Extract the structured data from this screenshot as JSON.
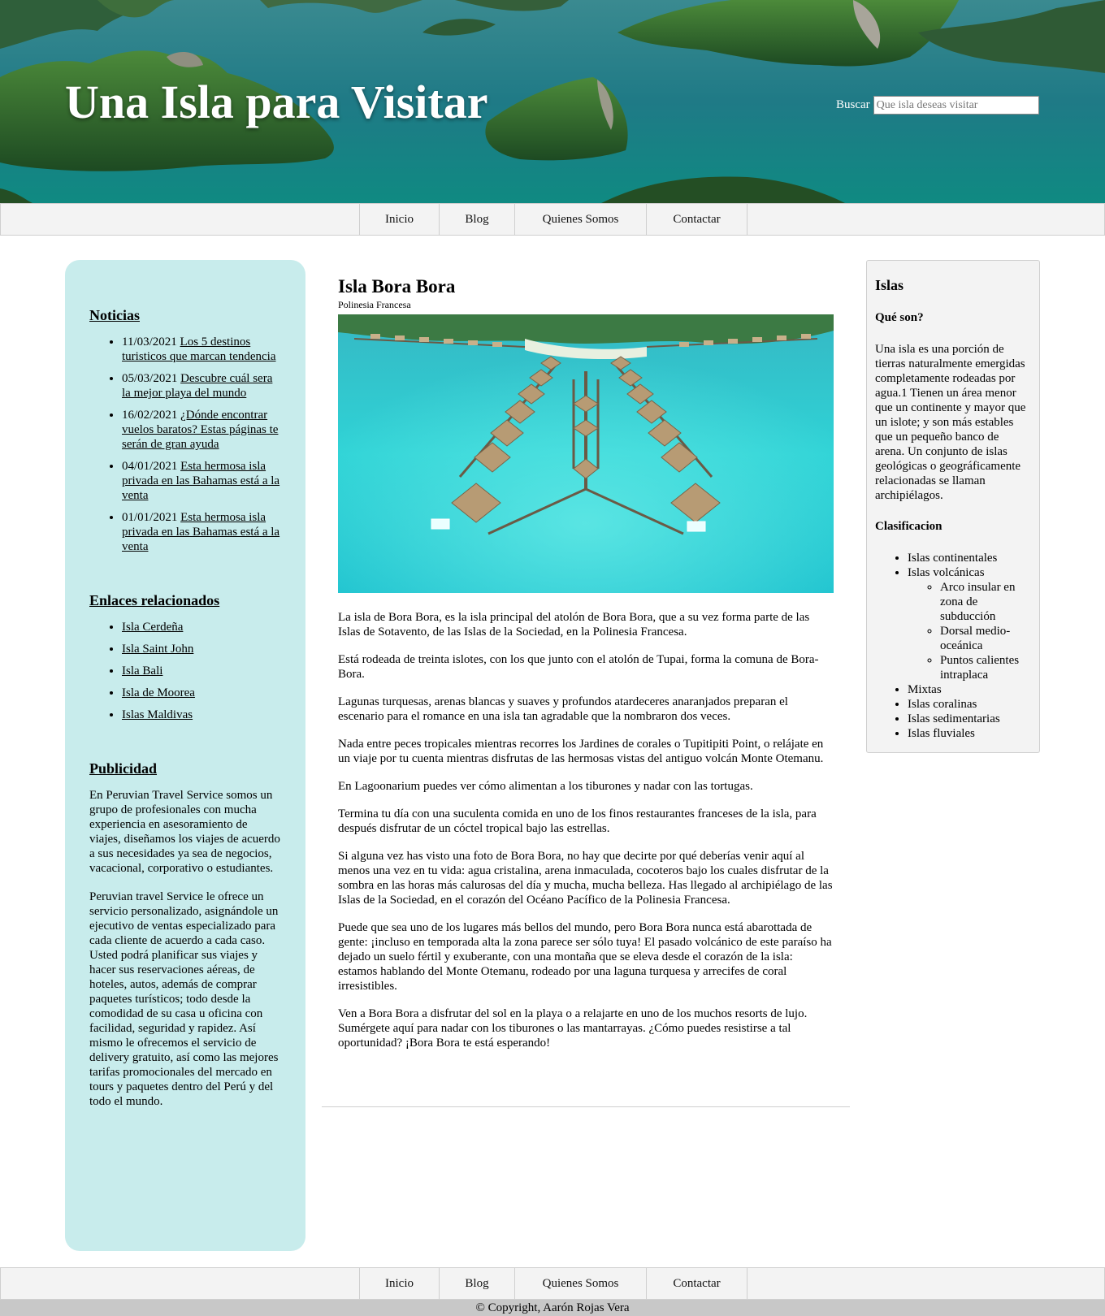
{
  "header": {
    "title": "Una Isla para Visitar",
    "search_label": "Buscar",
    "search_placeholder": "Que isla deseas visitar",
    "search_value": ""
  },
  "nav": {
    "items": [
      {
        "label": "Inicio"
      },
      {
        "label": "Blog"
      },
      {
        "label": "Quienes Somos"
      },
      {
        "label": "Contactar"
      }
    ]
  },
  "sidebar_left": {
    "news_title": "Noticias",
    "news": [
      {
        "date": "11/03/2021",
        "link": "Los 5 destinos turisticos que marcan tendencia"
      },
      {
        "date": "05/03/2021",
        "link": "Descubre cuál sera la mejor playa del mundo"
      },
      {
        "date": "16/02/2021",
        "link": "¿Dónde encontrar vuelos baratos? Estas páginas te serán de gran ayuda"
      },
      {
        "date": "04/01/2021",
        "link": "Esta hermosa isla privada en las Bahamas está a la venta"
      },
      {
        "date": "01/01/2021",
        "link": "Esta hermosa isla privada en las Bahamas está a la venta"
      }
    ],
    "links_title": "Enlaces relacionados",
    "links": [
      {
        "label": "Isla Cerdeña"
      },
      {
        "label": "Isla Saint John"
      },
      {
        "label": "Isla Bali"
      },
      {
        "label": "Isla de Moorea"
      },
      {
        "label": "Islas Maldivas"
      }
    ],
    "ads_title": "Publicidad",
    "ads_paragraphs": [
      "En Peruvian Travel Service somos un grupo de profesionales con mucha experiencia en asesoramiento de viajes, diseñamos los viajes de acuerdo a sus necesidades ya sea de negocios, vacacional, corporativo o estudiantes.",
      "Peruvian travel Service le ofrece un servicio personalizado, asignándole un ejecutivo de ventas especializado para cada cliente de acuerdo a cada caso. Usted podrá planificar sus viajes y hacer sus reservaciones aéreas, de hoteles, autos, además de comprar paquetes turísticos; todo desde la comodidad de su casa u oficina con facilidad, seguridad y rapidez. Así mismo le ofrecemos el servicio de delivery gratuito, así como las mejores tarifas promocionales del mercado en tours y paquetes dentro del Perú y del todo el mundo."
    ]
  },
  "main": {
    "title": "Isla Bora Bora",
    "subtitle": "Polinesia Francesa",
    "paragraphs": [
      "La isla de Bora Bora, es la isla principal del atolón de Bora Bora, que a su vez forma parte de las Islas de Sotavento, de las Islas de la Sociedad, en la Polinesia Francesa.",
      "Está rodeada de treinta islotes, con los que junto con el atolón de Tupai, forma la comuna de Bora-Bora.",
      "Lagunas turquesas, arenas blancas y suaves y profundos atardeceres anaranjados preparan el escenario para el romance en una isla tan agradable que la nombraron dos veces.",
      "Nada entre peces tropicales mientras recorres los Jardines de corales o Tupitipiti Point, o relájate en un viaje por tu cuenta mientras disfrutas de las hermosas vistas del antiguo volcán Monte Otemanu.",
      "En Lagoonarium puedes ver cómo alimentan a los tiburones y nadar con las tortugas.",
      "Termina tu día con una suculenta comida en uno de los finos restaurantes franceses de la isla, para después disfrutar de un cóctel tropical bajo las estrellas.",
      "Si alguna vez has visto una foto de Bora Bora, no hay que decirte por qué deberías venir aquí al menos una vez en tu vida: agua cristalina, arena inmaculada, cocoteros bajo los cuales disfrutar de la sombra en las horas más calurosas del día y mucha, mucha belleza. Has llegado al archipiélago de las Islas de la Sociedad, en el corazón del Océano Pacífico de la Polinesia Francesa.",
      "Puede que sea uno de los lugares más bellos del mundo, pero Bora Bora nunca está abarottada de gente: ¡incluso en temporada alta la zona parece ser sólo tuya! El pasado volcánico de este paraíso ha dejado un suelo fértil y exuberante, con una montaña que se eleva desde el corazón de la isla: estamos hablando del Monte Otemanu, rodeado por una laguna turquesa y arrecifes de coral irresistibles.",
      "Ven a Bora Bora a disfrutar del sol en la playa o a relajarte en uno de los muchos resorts de lujo. Sumérgete aquí para nadar con los tiburones o las mantarrayas. ¿Cómo puedes resistirse a tal oportunidad? ¡Bora Bora te está esperando!"
    ]
  },
  "sidebar_right": {
    "title": "Islas",
    "what_title": "Qué son?",
    "what_text": "Una isla es una porción de tierras naturalmente emergidas completamente rodeadas por agua.1 Tienen un área menor que un continente y mayor que un islote; y son más estables que un pequeño banco de arena. Un conjunto de islas geológicas o geográficamente relacionadas se llaman archipiélagos.",
    "class_title": "Clasificacion",
    "classes": {
      "c0": "Islas continentales",
      "c1": "Islas volcánicas",
      "c1_sub": [
        "Arco insular en zona de subducción",
        "Dorsal medio-oceánica",
        "Puntos calientes intraplaca"
      ],
      "c2": "Mixtas",
      "c3": "Islas coralinas",
      "c4": "Islas sedimentarias",
      "c5": "Islas fluviales"
    }
  },
  "footer": {
    "copyright": "© Copyright, Aarón Rojas Vera"
  }
}
